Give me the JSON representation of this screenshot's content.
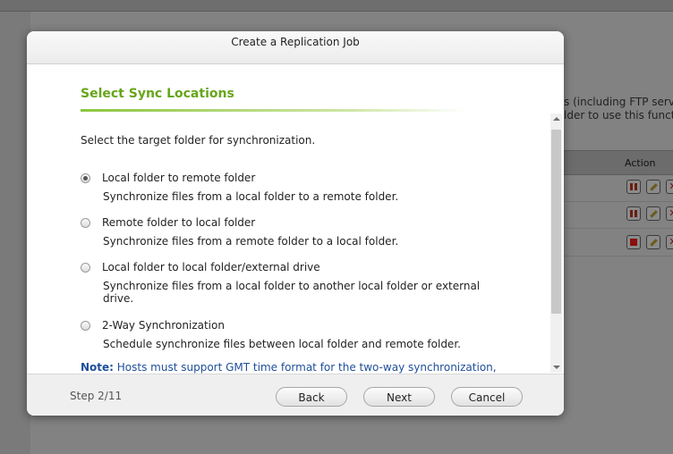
{
  "background": {
    "text_line1": "s (including FTP serve",
    "text_line2": "lder to use this functi",
    "action_header": "Action"
  },
  "dialog": {
    "title": "Create a Replication Job",
    "section_title": "Select Sync Locations",
    "intro": "Select the target folder for synchronization.",
    "options": [
      {
        "label": "Local folder to remote folder",
        "description": "Synchronize files from a local folder to a remote folder.",
        "selected": true
      },
      {
        "label": "Remote folder to local folder",
        "description": "Synchronize files from a remote folder to a local folder.",
        "selected": false
      },
      {
        "label": "Local folder to local folder/external drive",
        "description": "Synchronize files from a local folder to another local folder or external drive.",
        "selected": false
      },
      {
        "label": "2-Way Synchronization",
        "description": "Schedule synchronize files between local folder and remote folder.",
        "selected": false
      }
    ],
    "note_label": "Note:",
    "note_text": " Hosts must support GMT time format for the two-way synchronization,",
    "step": "Step 2/11",
    "buttons": {
      "back": "Back",
      "next": "Next",
      "cancel": "Cancel"
    }
  },
  "colors": {
    "accent_green": "#67a51b",
    "note_blue": "#1e4e9a"
  }
}
